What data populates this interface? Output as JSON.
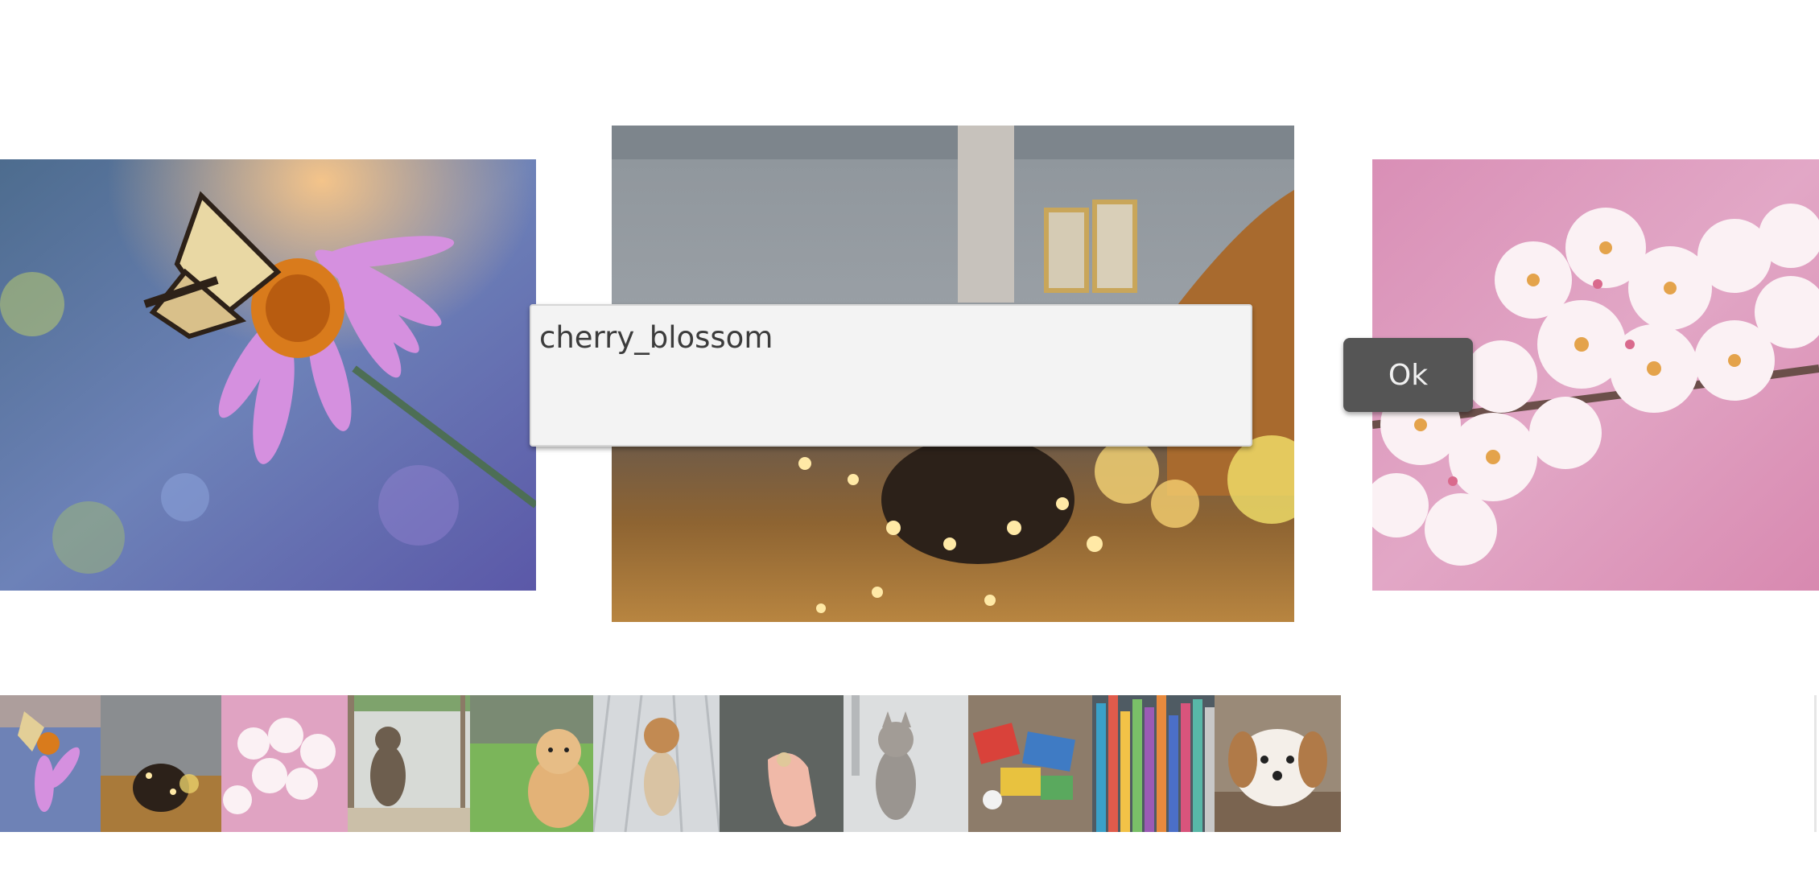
{
  "name_input": {
    "value": "cherry_blossom"
  },
  "ok_button": {
    "label": "Ok"
  },
  "slides": {
    "left": {
      "icon": "butterfly-on-coneflower-photo"
    },
    "center": {
      "icon": "fairy-lights-bowl-photo"
    },
    "right": {
      "icon": "cherry-blossom-photo"
    }
  },
  "thumbnails": [
    {
      "icon": "butterfly-flower-thumbnail"
    },
    {
      "icon": "fairy-lights-thumbnail"
    },
    {
      "icon": "cherry-blossom-thumbnail"
    },
    {
      "icon": "kitten-window-thumbnail"
    },
    {
      "icon": "puppy-grass-thumbnail"
    },
    {
      "icon": "puppy-deck-thumbnail"
    },
    {
      "icon": "hand-pill-thumbnail"
    },
    {
      "icon": "tabby-kitten-thumbnail"
    },
    {
      "icon": "toys-thumbnail"
    },
    {
      "icon": "colored-pencils-thumbnail"
    },
    {
      "icon": "puppy-lying-thumbnail"
    }
  ],
  "colors": {
    "dialog_bg": "#f3f3f3",
    "ok_button_bg": "#555555",
    "page_bg": "#ffffff"
  }
}
